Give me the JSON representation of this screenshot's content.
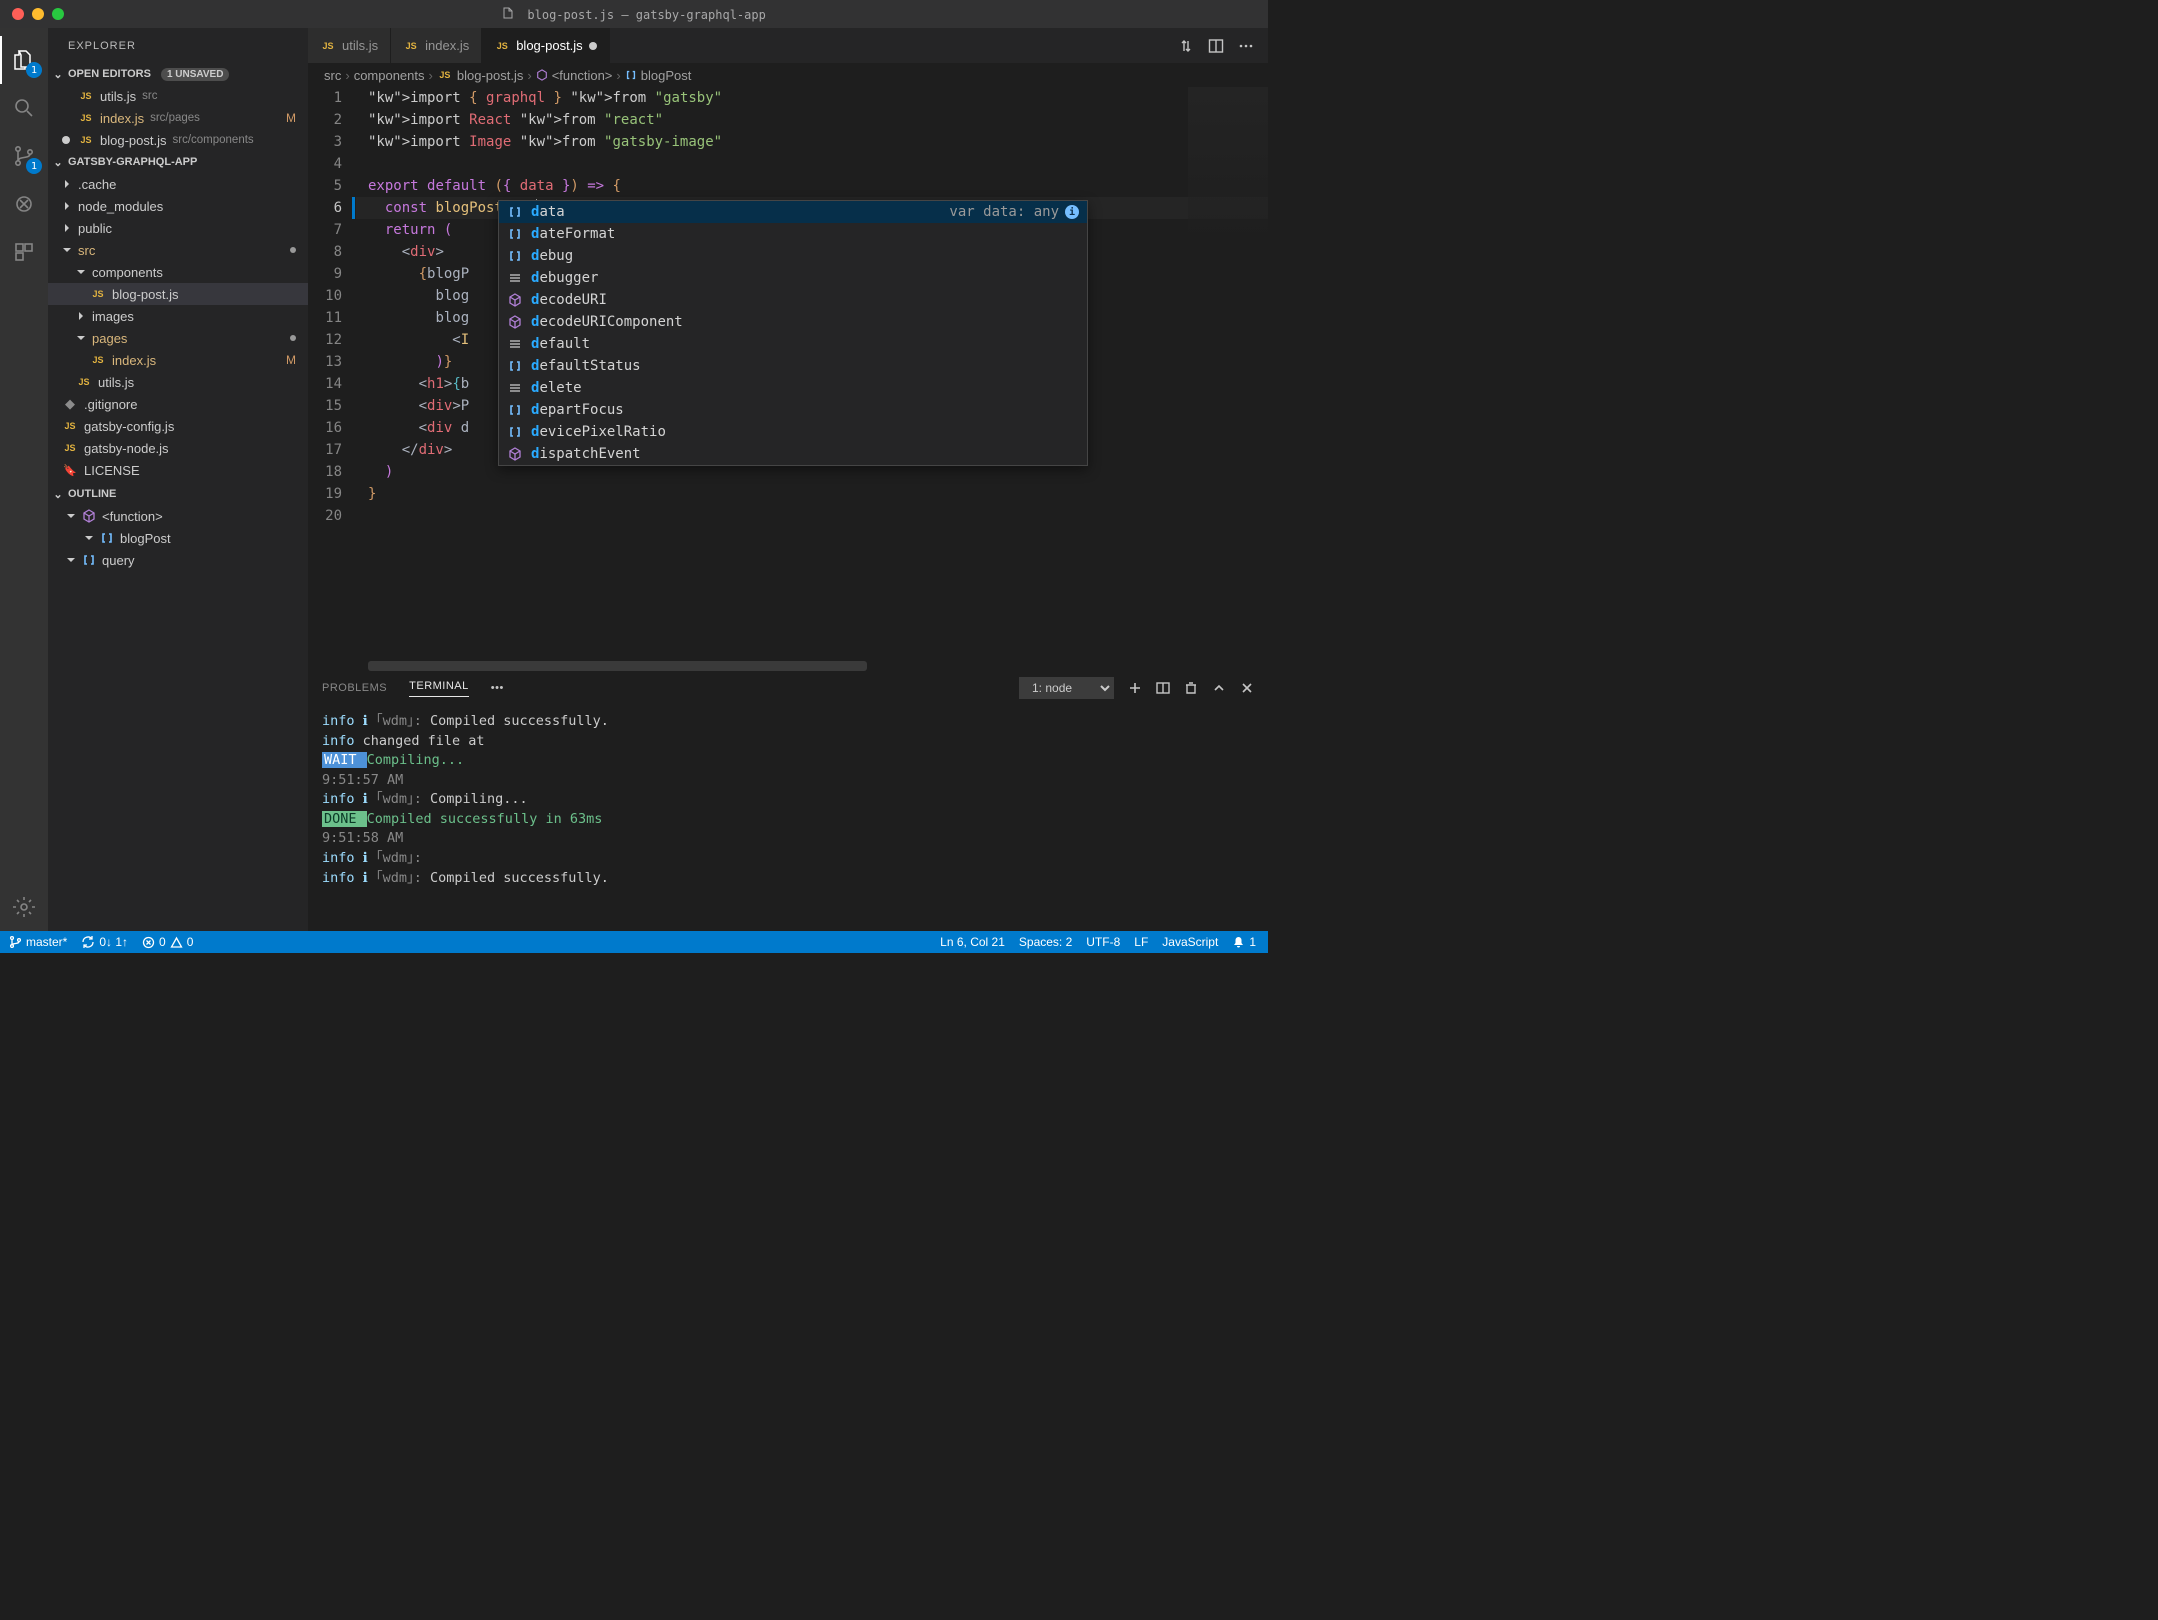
{
  "window": {
    "title_file": "blog-post.js",
    "title_project": " — gatsby-graphql-app"
  },
  "activity_bar": {
    "explorer_badge": "1",
    "scm_badge": "1"
  },
  "sidebar": {
    "title": "EXPLORER",
    "open_editors": {
      "label": "OPEN EDITORS",
      "badge": "1 UNSAVED",
      "items": [
        {
          "name": "utils.js",
          "sub": "src",
          "mod": false,
          "dirty": false,
          "meta": ""
        },
        {
          "name": "index.js",
          "sub": "src/pages",
          "mod": true,
          "dirty": false,
          "meta": "M"
        },
        {
          "name": "blog-post.js",
          "sub": "src/components",
          "mod": false,
          "dirty": true,
          "meta": ""
        }
      ]
    },
    "workspace": {
      "label": "GATSBY-GRAPHQL-APP",
      "tree": [
        {
          "kind": "folder",
          "name": ".cache",
          "open": false,
          "depth": 0
        },
        {
          "kind": "folder",
          "name": "node_modules",
          "open": false,
          "depth": 0
        },
        {
          "kind": "folder",
          "name": "public",
          "open": false,
          "depth": 0
        },
        {
          "kind": "folder",
          "name": "src",
          "open": true,
          "depth": 0,
          "mod": true,
          "dot": true
        },
        {
          "kind": "folder",
          "name": "components",
          "open": true,
          "depth": 1
        },
        {
          "kind": "file",
          "name": "blog-post.js",
          "depth": 2,
          "lang": "js",
          "selected": true
        },
        {
          "kind": "folder",
          "name": "images",
          "open": false,
          "depth": 1
        },
        {
          "kind": "folder",
          "name": "pages",
          "open": true,
          "depth": 1,
          "mod": true,
          "dot": true
        },
        {
          "kind": "file",
          "name": "index.js",
          "depth": 2,
          "lang": "js",
          "mod": true,
          "meta": "M"
        },
        {
          "kind": "file",
          "name": "utils.js",
          "depth": 1,
          "lang": "js"
        },
        {
          "kind": "file",
          "name": ".gitignore",
          "depth": 0,
          "lang": "git"
        },
        {
          "kind": "file",
          "name": "gatsby-config.js",
          "depth": 0,
          "lang": "js"
        },
        {
          "kind": "file",
          "name": "gatsby-node.js",
          "depth": 0,
          "lang": "js"
        },
        {
          "kind": "file",
          "name": "LICENSE",
          "depth": 0,
          "lang": "cert"
        }
      ]
    },
    "outline": {
      "label": "OUTLINE",
      "items": [
        {
          "name": "<function>",
          "icon": "cube",
          "depth": 0
        },
        {
          "name": "blogPost",
          "icon": "brackets",
          "depth": 1
        },
        {
          "name": "query",
          "icon": "brackets",
          "depth": 0
        }
      ]
    }
  },
  "tabs": [
    {
      "name": "utils.js",
      "active": false
    },
    {
      "name": "index.js",
      "active": false
    },
    {
      "name": "blog-post.js",
      "active": true,
      "dirty": true
    }
  ],
  "breadcrumbs": [
    "src",
    "components",
    "blog-post.js",
    "<function>",
    "blogPost"
  ],
  "code": {
    "lines": [
      "import { graphql } from \"gatsby\"",
      "import React from \"react\"",
      "import Image from \"gatsby-image\"",
      "",
      "export default ({ data }) => {",
      "  const blogPost = d",
      "  return (",
      "    <div>",
      "      {blogP",
      "        blog",
      "        blog",
      "          <I",
      "        )}",
      "      <h1>{b",
      "      <div>P",
      "      <div d",
      "    </div>",
      "  )",
      "}",
      ""
    ],
    "current_line": 6
  },
  "suggest": {
    "detail": "var data: any",
    "items": [
      {
        "icon": "var",
        "label": "data",
        "selected": true
      },
      {
        "icon": "var",
        "label": "dateFormat"
      },
      {
        "icon": "var",
        "label": "debug"
      },
      {
        "icon": "key",
        "label": "debugger"
      },
      {
        "icon": "meth",
        "label": "decodeURI"
      },
      {
        "icon": "meth",
        "label": "decodeURIComponent"
      },
      {
        "icon": "key",
        "label": "default"
      },
      {
        "icon": "var",
        "label": "defaultStatus"
      },
      {
        "icon": "key",
        "label": "delete"
      },
      {
        "icon": "var",
        "label": "departFocus"
      },
      {
        "icon": "var",
        "label": "devicePixelRatio"
      },
      {
        "icon": "meth",
        "label": "dispatchEvent"
      }
    ]
  },
  "panel": {
    "tabs": {
      "problems": "PROBLEMS",
      "terminal": "TERMINAL"
    },
    "select": "1: node",
    "terminal_lines": [
      {
        "segs": [
          {
            "t": "info ",
            "c": "t-info"
          },
          {
            "t": "ℹ ",
            "c": "t-info"
          },
          {
            "t": "｢wdm｣: ",
            "c": "t-dim"
          },
          {
            "t": "Compiled successfully.",
            "c": ""
          }
        ]
      },
      {
        "segs": [
          {
            "t": "info",
            "c": "t-info"
          },
          {
            "t": " changed file at",
            "c": ""
          }
        ]
      },
      {
        "segs": [
          {
            "t": " WAIT ",
            "c": "t-wait"
          },
          {
            "t": " Compiling...",
            "c": "t-green"
          }
        ]
      },
      {
        "segs": [
          {
            "t": "9:51:57 AM",
            "c": "t-dim"
          }
        ]
      },
      {
        "segs": [
          {
            "t": "",
            "c": ""
          }
        ]
      },
      {
        "segs": [
          {
            "t": "info ",
            "c": "t-info"
          },
          {
            "t": "ℹ ",
            "c": "t-info"
          },
          {
            "t": "｢wdm｣: ",
            "c": "t-dim"
          },
          {
            "t": "Compiling...",
            "c": ""
          }
        ]
      },
      {
        "segs": [
          {
            "t": " DONE ",
            "c": "t-done"
          },
          {
            "t": " Compiled successfully in 63ms",
            "c": "t-green"
          }
        ]
      },
      {
        "segs": [
          {
            "t": "9:51:58 AM",
            "c": "t-dim"
          }
        ]
      },
      {
        "segs": [
          {
            "t": "",
            "c": ""
          }
        ]
      },
      {
        "segs": [
          {
            "t": "info ",
            "c": "t-info"
          },
          {
            "t": "ℹ ",
            "c": "t-info"
          },
          {
            "t": "｢wdm｣:",
            "c": "t-dim"
          }
        ]
      },
      {
        "segs": [
          {
            "t": "info ",
            "c": "t-info"
          },
          {
            "t": "ℹ ",
            "c": "t-info"
          },
          {
            "t": "｢wdm｣: ",
            "c": "t-dim"
          },
          {
            "t": "Compiled successfully.",
            "c": ""
          }
        ]
      }
    ]
  },
  "status": {
    "branch": "master*",
    "sync": "0↓ 1↑",
    "errors": "0",
    "warnings": "0",
    "cursor": "Ln 6, Col 21",
    "spaces": "Spaces: 2",
    "encoding": "UTF-8",
    "eol": "LF",
    "lang": "JavaScript",
    "notif": "1"
  }
}
